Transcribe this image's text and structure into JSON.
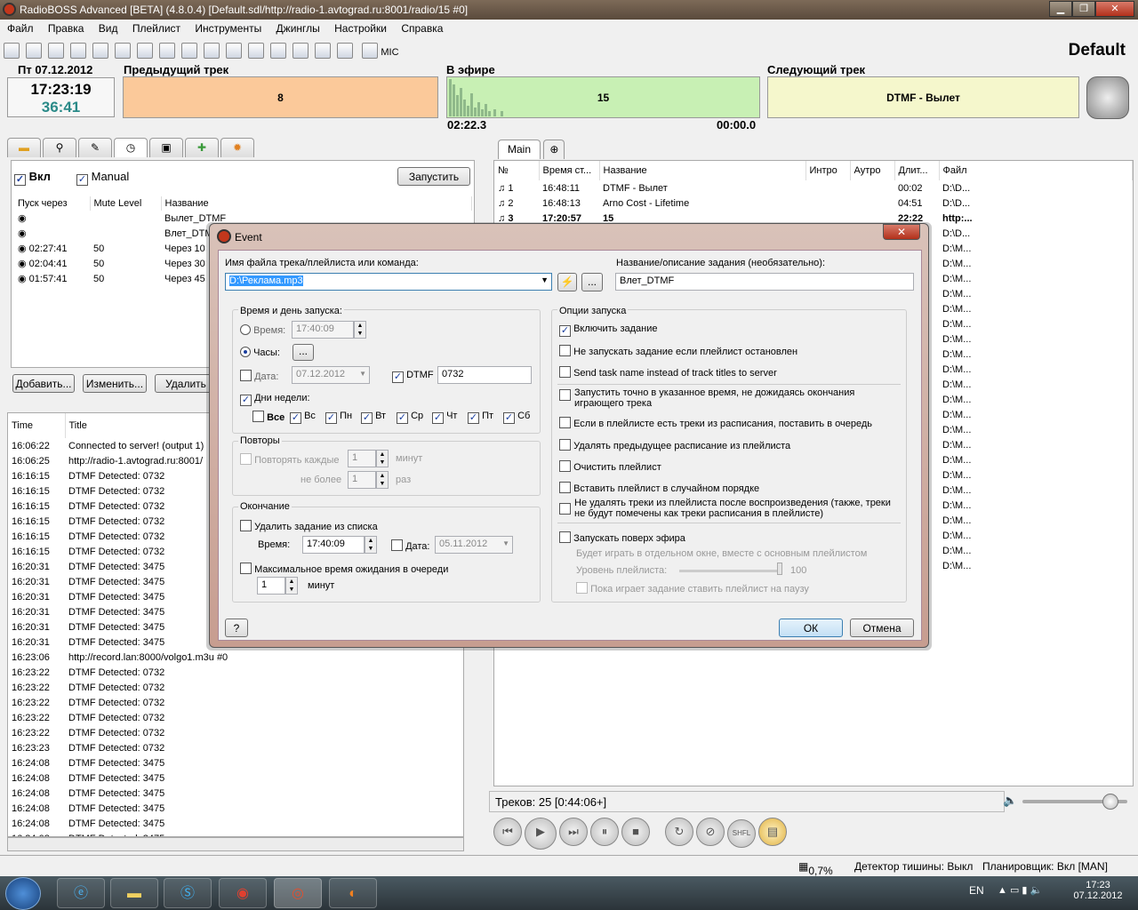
{
  "app": {
    "title": "RadioBOSS Advanced [BETA] (4.8.0.4)   [Default.sdl/http://radio-1.avtograd.ru:8001/radio/15 #0]",
    "profile": "Default"
  },
  "menu": [
    "Файл",
    "Правка",
    "Вид",
    "Плейлист",
    "Инструменты",
    "Джинглы",
    "Настройки",
    "Справка"
  ],
  "toolbar": {
    "mic_label": "MIC"
  },
  "clock": {
    "date": "Пт 07.12.2012",
    "time": "17:23:19",
    "remaining": "36:41"
  },
  "previous": {
    "header": "Предыдущий трек",
    "value": "8"
  },
  "on_air": {
    "header": "В эфире",
    "value": "15",
    "elapsed": "02:22.3",
    "left": "00:00.0"
  },
  "next": {
    "header": "Следующий трек",
    "value": "DTMF - Вылет"
  },
  "scheduler": {
    "enabled_label": "Вкл",
    "manual_label": "Manual",
    "run_button": "Запустить",
    "columns": [
      "Пуск через",
      "Mute Level",
      "Название"
    ],
    "rows": [
      {
        "start": "",
        "mute": "",
        "name": "Вылет_DTMF"
      },
      {
        "start": "",
        "mute": "",
        "name": "Влет_DTMF"
      },
      {
        "start": "02:27:41",
        "mute": "50",
        "name": "Через 10"
      },
      {
        "start": "02:04:41",
        "mute": "50",
        "name": "Через 30"
      },
      {
        "start": "01:57:41",
        "mute": "50",
        "name": "Через 45"
      }
    ],
    "add_button": "Добавить...",
    "edit_button": "Изменить...",
    "delete_button": "Удалить"
  },
  "log": {
    "columns": [
      "Time",
      "Title"
    ],
    "rows": [
      [
        "16:06:22",
        "Connected to server! (output 1)"
      ],
      [
        "16:06:25",
        "http://radio-1.avtograd.ru:8001/"
      ],
      [
        "16:16:15",
        "DTMF Detected: 0732"
      ],
      [
        "16:16:15",
        "DTMF Detected: 0732"
      ],
      [
        "16:16:15",
        "DTMF Detected: 0732"
      ],
      [
        "16:16:15",
        "DTMF Detected: 0732"
      ],
      [
        "16:16:15",
        "DTMF Detected: 0732"
      ],
      [
        "16:16:15",
        "DTMF Detected: 0732"
      ],
      [
        "16:20:31",
        "DTMF Detected: 3475"
      ],
      [
        "16:20:31",
        "DTMF Detected: 3475"
      ],
      [
        "16:20:31",
        "DTMF Detected: 3475"
      ],
      [
        "16:20:31",
        "DTMF Detected: 3475"
      ],
      [
        "16:20:31",
        "DTMF Detected: 3475"
      ],
      [
        "16:20:31",
        "DTMF Detected: 3475"
      ],
      [
        "16:23:06",
        "http://record.lan:8000/volgo1.m3u #0"
      ],
      [
        "16:23:22",
        "DTMF Detected: 0732"
      ],
      [
        "16:23:22",
        "DTMF Detected: 0732"
      ],
      [
        "16:23:22",
        "DTMF Detected: 0732"
      ],
      [
        "16:23:22",
        "DTMF Detected: 0732"
      ],
      [
        "16:23:22",
        "DTMF Detected: 0732"
      ],
      [
        "16:23:23",
        "DTMF Detected: 0732"
      ],
      [
        "16:24:08",
        "DTMF Detected: 3475"
      ],
      [
        "16:24:08",
        "DTMF Detected: 3475"
      ],
      [
        "16:24:08",
        "DTMF Detected: 3475"
      ],
      [
        "16:24:08",
        "DTMF Detected: 3475"
      ],
      [
        "16:24:08",
        "DTMF Detected: 3475"
      ],
      [
        "16:24:08",
        "DTMF Detected: 3475"
      ]
    ]
  },
  "playlist": {
    "tab": "Main",
    "columns": [
      "№",
      "Время ст...",
      "Название",
      "Интро",
      "Аутро",
      "Длит...",
      "Файл"
    ],
    "rows": [
      {
        "n": "1",
        "time": "16:48:11",
        "name": "DTMF - Вылет",
        "dur": "00:02",
        "file": "D:\\D..."
      },
      {
        "n": "2",
        "time": "16:48:13",
        "name": "Arno Cost - Lifetime",
        "dur": "04:51",
        "file": "D:\\D..."
      },
      {
        "n": "3",
        "time": "17:20:57",
        "name": "15",
        "dur": "22:22",
        "file": "http:..."
      }
    ],
    "file_tail": [
      "D:\\D...",
      "D:\\M...",
      "D:\\M...",
      "D:\\M...",
      "D:\\M...",
      "D:\\M...",
      "D:\\M...",
      "D:\\M...",
      "D:\\M...",
      "D:\\M...",
      "D:\\M...",
      "D:\\M...",
      "D:\\M...",
      "D:\\M...",
      "D:\\M...",
      "D:\\M...",
      "D:\\M...",
      "D:\\M...",
      "D:\\M...",
      "D:\\M...",
      "D:\\M...",
      "D:\\M...",
      "D:\\M..."
    ],
    "info": "Треков: 25 [0:44:06+]",
    "volume": 0.82
  },
  "status": {
    "cpu": "0,7%",
    "silence": "Детектор тишины: Выкл",
    "scheduler": "Планировщик: Вкл [MAN]"
  },
  "taskbar": {
    "lang": "EN",
    "time": "17:23",
    "date": "07.12.2012"
  },
  "dialog": {
    "title": "Event",
    "file_label": "Имя файла трека/плейлиста или команда:",
    "file_value": "D:\\Реклама.mp3",
    "name_label": "Название/описание задания (необязательно):",
    "name_value": "Влет_DTMF",
    "time_group": "Время и день запуска:",
    "time_label": "Время:",
    "time_value": "17:40:09",
    "hours_label": "Часы:",
    "date_label": "Дата:",
    "date_value": "07.12.2012",
    "dtmf_label": "DTMF",
    "dtmf_value": "0732",
    "weekdays_label": "Дни недели:",
    "days": [
      "Все",
      "Вс",
      "Пн",
      "Вт",
      "Ср",
      "Чт",
      "Пт",
      "Сб"
    ],
    "repeat_group": "Повторы",
    "repeat_every": "Повторять каждые",
    "repeat_value": "1",
    "repeat_unit": "минут",
    "not_more": "не более",
    "not_more_value": "1",
    "not_more_unit": "раз",
    "end_group": "Окончание",
    "delete_task": "Удалить задание из списка",
    "end_time_label": "Время:",
    "end_time_value": "17:40:09",
    "end_date_label": "Дата:",
    "end_date_value": "05.11.2012",
    "max_wait": "Максимальное время ожидания в очереди",
    "max_wait_value": "1",
    "max_wait_unit": "минут",
    "options_group": "Опции запуска",
    "options": [
      "Включить задание",
      "Не запускать задание если плейлист остановлен",
      "Send task name instead of track titles to server",
      "Запустить точно в указанное время, не дожидаясь окончания играющего трека",
      "Если в плейлисте есть треки из расписания, поставить в очередь",
      "Удалять предыдущее расписание из плейлиста",
      "Очистить плейлист",
      "Вставить плейлист в случайном порядке",
      "Не удалять треки из плейлиста после воспроизведения (также, треки не будут помечены как треки расписания в плейлисте)",
      "Запускать поверх эфира"
    ],
    "separate_window": "Будет играть в отдельном окне, вместе с основным плейлистом",
    "level_label": "Уровень плейлиста:",
    "level_value": "100",
    "pause_label": "Пока играет задание ставить плейлист на паузу",
    "help": "?",
    "ok": "ОК",
    "cancel": "Отмена"
  }
}
